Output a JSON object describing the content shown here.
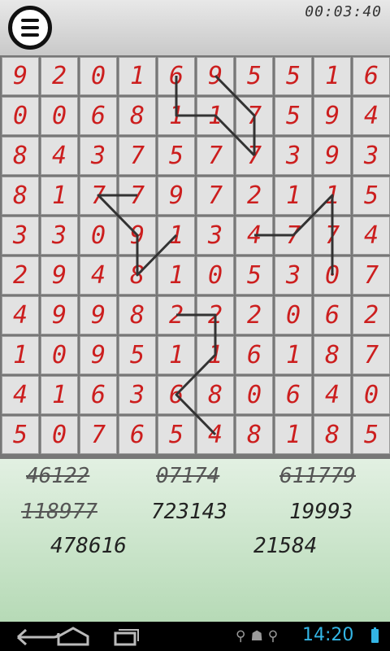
{
  "header": {
    "timer": "00:03:40"
  },
  "grid": {
    "rows": [
      [
        "9",
        "2",
        "0",
        "1",
        "6",
        "9",
        "5",
        "5",
        "1",
        "6"
      ],
      [
        "0",
        "0",
        "6",
        "8",
        "1",
        "1",
        "7",
        "5",
        "9",
        "4"
      ],
      [
        "8",
        "4",
        "3",
        "7",
        "5",
        "7",
        "7",
        "3",
        "9",
        "3"
      ],
      [
        "8",
        "1",
        "7",
        "7",
        "9",
        "7",
        "2",
        "1",
        "1",
        "5"
      ],
      [
        "3",
        "3",
        "0",
        "9",
        "1",
        "3",
        "4",
        "7",
        "7",
        "4"
      ],
      [
        "2",
        "9",
        "4",
        "8",
        "1",
        "0",
        "5",
        "3",
        "0",
        "7"
      ],
      [
        "4",
        "9",
        "9",
        "8",
        "2",
        "2",
        "2",
        "0",
        "6",
        "2"
      ],
      [
        "1",
        "0",
        "9",
        "5",
        "1",
        "1",
        "6",
        "1",
        "8",
        "7"
      ],
      [
        "4",
        "1",
        "6",
        "3",
        "6",
        "8",
        "0",
        "6",
        "4",
        "0"
      ],
      [
        "5",
        "0",
        "7",
        "6",
        "5",
        "4",
        "8",
        "1",
        "8",
        "5"
      ]
    ]
  },
  "paths": [
    [
      [
        5,
        0
      ],
      [
        6,
        1
      ],
      [
        6,
        2
      ]
    ],
    [
      [
        4,
        0
      ],
      [
        4,
        1
      ],
      [
        5,
        1
      ],
      [
        6,
        2
      ]
    ],
    [
      [
        3,
        3
      ],
      [
        2,
        3
      ],
      [
        3,
        4
      ],
      [
        3,
        5
      ],
      [
        4,
        4
      ]
    ],
    [
      [
        6,
        4
      ],
      [
        7,
        4
      ],
      [
        8,
        3
      ],
      [
        8,
        5
      ]
    ],
    [
      [
        4,
        6
      ],
      [
        5,
        6
      ],
      [
        5,
        7
      ],
      [
        4,
        8
      ],
      [
        5,
        9
      ]
    ]
  ],
  "targets": [
    {
      "value": "46122",
      "done": true
    },
    {
      "value": "07174",
      "done": true
    },
    {
      "value": "611779",
      "done": true
    },
    {
      "value": "118977",
      "done": true
    },
    {
      "value": "723143",
      "done": false
    },
    {
      "value": "19993",
      "done": false
    },
    {
      "value": "478616",
      "done": false
    },
    {
      "value": "21584",
      "done": false
    }
  ],
  "status": {
    "clock": "14:20"
  },
  "colors": {
    "digit": "#cc1e1e",
    "accent": "#33b5e5",
    "path": "#333333"
  }
}
